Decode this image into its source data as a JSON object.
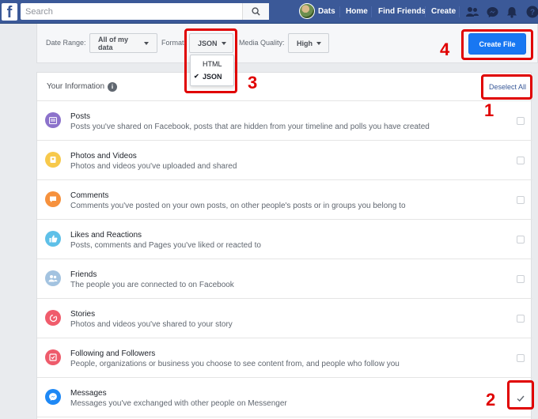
{
  "topbar": {
    "logo": "f",
    "search_placeholder": "Search",
    "user_name": "Dats",
    "nav": [
      "Home",
      "Find Friends",
      "Create"
    ]
  },
  "filters": {
    "date_range_label": "Date Range:",
    "date_range_value": "All of my data",
    "format_label": "Format:",
    "format_value": "JSON",
    "media_quality_label": "Media Quality:",
    "media_quality_value": "High",
    "create_button": "Create File"
  },
  "format_menu": {
    "options": [
      {
        "label": "HTML",
        "selected": false
      },
      {
        "label": "JSON",
        "selected": true
      }
    ]
  },
  "panel": {
    "title": "Your Information",
    "deselect_all": "Deselect All",
    "items": [
      {
        "title": "Posts",
        "desc": "Posts you've shared on Facebook, posts that are hidden from your timeline and polls you have created",
        "icon": "posts-icon",
        "color": "#8c72cb",
        "checked": false
      },
      {
        "title": "Photos and Videos",
        "desc": "Photos and videos you've uploaded and shared",
        "icon": "photos-icon",
        "color": "#f7c94b",
        "checked": false
      },
      {
        "title": "Comments",
        "desc": "Comments you've posted on your own posts, on other people's posts or in groups you belong to",
        "icon": "comments-icon",
        "color": "#f6913d",
        "checked": false
      },
      {
        "title": "Likes and Reactions",
        "desc": "Posts, comments and Pages you've liked or reacted to",
        "icon": "like-icon",
        "color": "#5ec0e8",
        "checked": false
      },
      {
        "title": "Friends",
        "desc": "The people you are connected to on Facebook",
        "icon": "friends-icon",
        "color": "#a3c3e0",
        "checked": false
      },
      {
        "title": "Stories",
        "desc": "Photos and videos you've shared to your story",
        "icon": "stories-icon",
        "color": "#f05c6c",
        "checked": false
      },
      {
        "title": "Following and Followers",
        "desc": "People, organizations or business you choose to see content from, and people who follow you",
        "icon": "following-icon",
        "color": "#ee5b6b",
        "checked": false
      },
      {
        "title": "Messages",
        "desc": "Messages you've exchanged with other people on Messenger",
        "icon": "messenger-icon",
        "color": "#1e88f5",
        "checked": true
      }
    ]
  },
  "annotations": [
    "1",
    "2",
    "3",
    "4"
  ],
  "colors": {
    "brand": "#3b5998",
    "accent": "#1877f2",
    "annotation": "#e00000"
  }
}
